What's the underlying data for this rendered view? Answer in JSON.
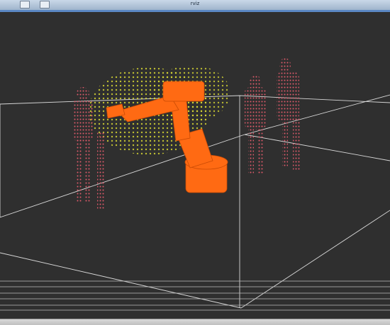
{
  "window": {
    "title": "rviz"
  },
  "scene": {
    "background": "#2f2f2f",
    "grid_color": "#d8d8d8",
    "robot_color": "#ff6a13",
    "workspace_color": "#d7d733",
    "human_color": "#e05a6a"
  }
}
